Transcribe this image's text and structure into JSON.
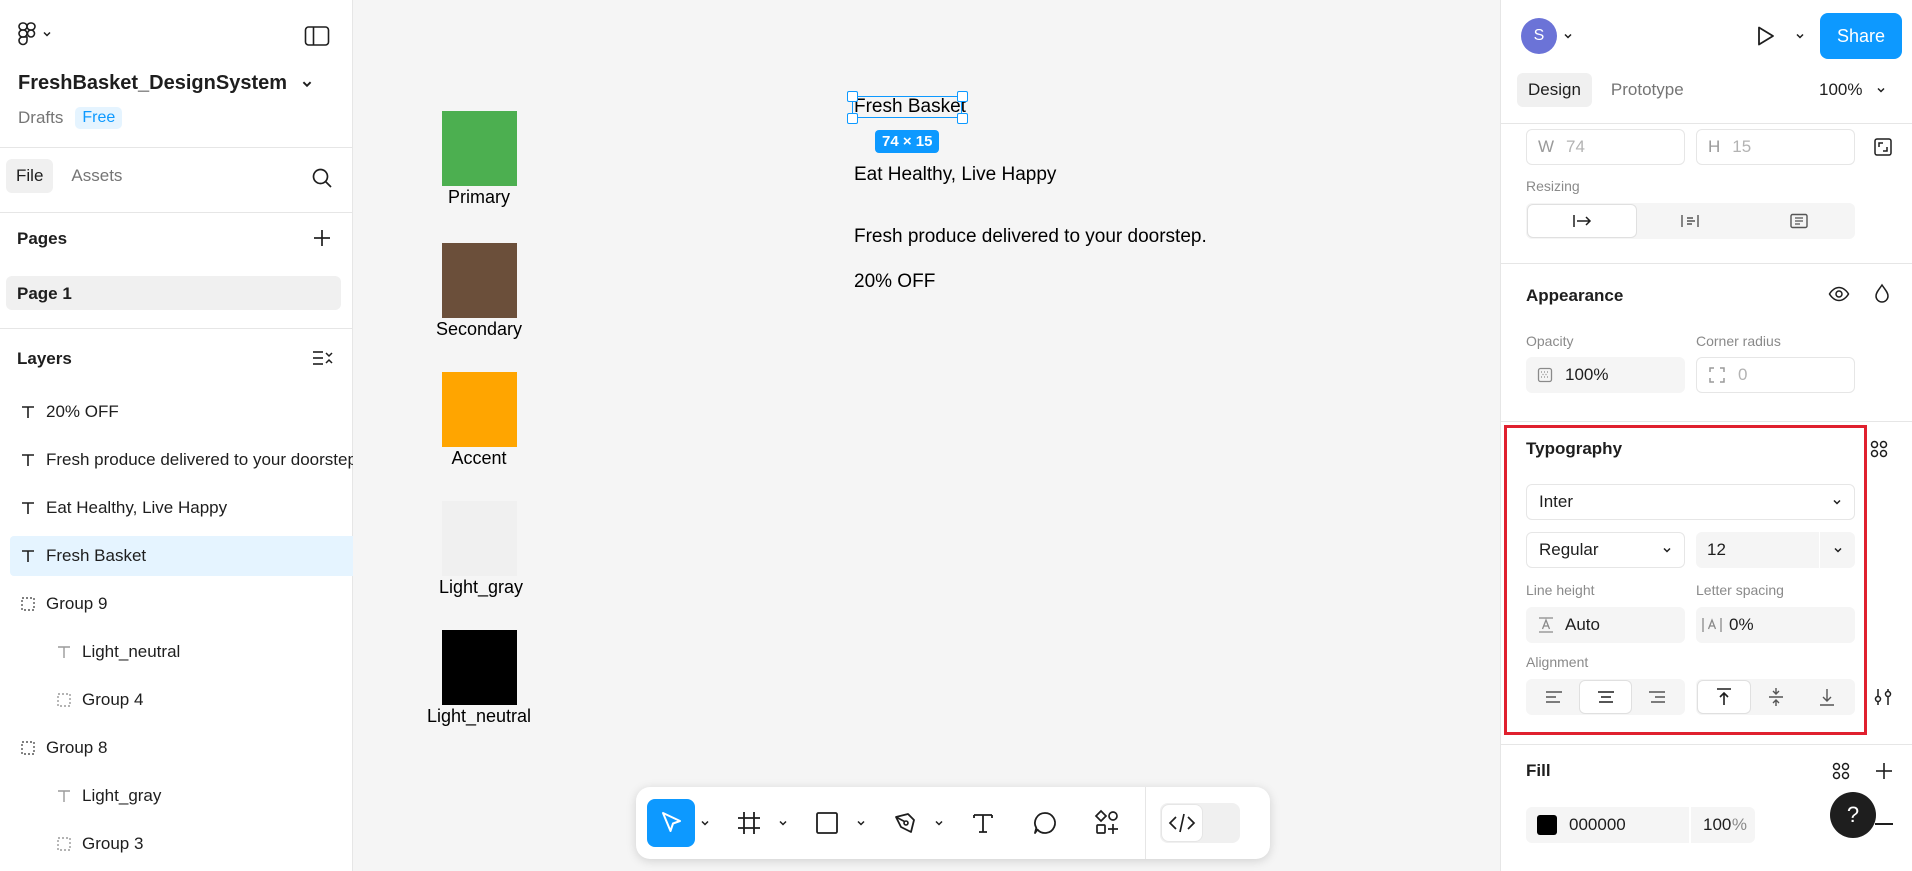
{
  "file": {
    "title": "FreshBasket_DesignSystem",
    "location": "Drafts",
    "plan_badge": "Free"
  },
  "left_tabs": [
    {
      "label": "File",
      "active": true
    },
    {
      "label": "Assets",
      "active": false
    }
  ],
  "pages": {
    "heading": "Pages",
    "items": [
      "Page 1"
    ]
  },
  "layers": {
    "heading": "Layers",
    "items": [
      {
        "label": "20% OFF",
        "icon": "text-icon",
        "indent": 0
      },
      {
        "label": "Fresh produce delivered to your doorstep.",
        "icon": "text-icon",
        "indent": 0
      },
      {
        "label": "Eat Healthy, Live Happy",
        "icon": "text-icon",
        "indent": 0
      },
      {
        "label": "Fresh Basket",
        "icon": "text-icon",
        "indent": 0,
        "selected": true
      },
      {
        "label": "Group 9",
        "icon": "group-icon",
        "indent": 0
      },
      {
        "label": "Light_neutral",
        "icon": "text-icon",
        "indent": 1
      },
      {
        "label": "Group 4",
        "icon": "group-icon",
        "indent": 1
      },
      {
        "label": "Group 8",
        "icon": "group-icon",
        "indent": 0
      },
      {
        "label": "Light_gray",
        "icon": "text-icon",
        "indent": 1
      },
      {
        "label": "Group 3",
        "icon": "group-icon",
        "indent": 1
      }
    ]
  },
  "canvas": {
    "swatches": [
      {
        "label": "Primary",
        "color": "#4CAF50"
      },
      {
        "label": "Secondary",
        "color": "#6B4F3A"
      },
      {
        "label": "Accent",
        "color": "#FFA500"
      },
      {
        "label": "Light_gray",
        "color": "#F0F0F0"
      },
      {
        "label": "Light_neutral",
        "color": "#000000"
      }
    ],
    "texts": {
      "brand": "Fresh Basket",
      "tagline": "Eat Healthy, Live Happy",
      "description": "Fresh produce delivered to your doorstep.",
      "discount": "20% OFF"
    },
    "selection_size": "74 × 15"
  },
  "header": {
    "avatar_initial": "S",
    "share_label": "Share"
  },
  "right_tabs": [
    {
      "label": "Design",
      "active": true
    },
    {
      "label": "Prototype",
      "active": false
    }
  ],
  "zoom": "100%",
  "dimensions": {
    "w_label": "W",
    "w_value": "74",
    "h_label": "H",
    "h_value": "15",
    "resizing_label": "Resizing"
  },
  "appearance": {
    "heading": "Appearance",
    "opacity_label": "Opacity",
    "opacity_value": "100%",
    "corner_label": "Corner radius",
    "corner_value": "0"
  },
  "typography": {
    "heading": "Typography",
    "font_family": "Inter",
    "font_weight": "Regular",
    "font_size": "12",
    "line_height_label": "Line height",
    "line_height_value": "Auto",
    "letter_spacing_label": "Letter spacing",
    "letter_spacing_value": "0%",
    "alignment_label": "Alignment"
  },
  "fill": {
    "heading": "Fill",
    "hex": "000000",
    "opacity": "100",
    "unit": "%",
    "swatch_color": "#000000"
  },
  "accent_color": "#0D99FF",
  "highlight_color": "#E0202E"
}
